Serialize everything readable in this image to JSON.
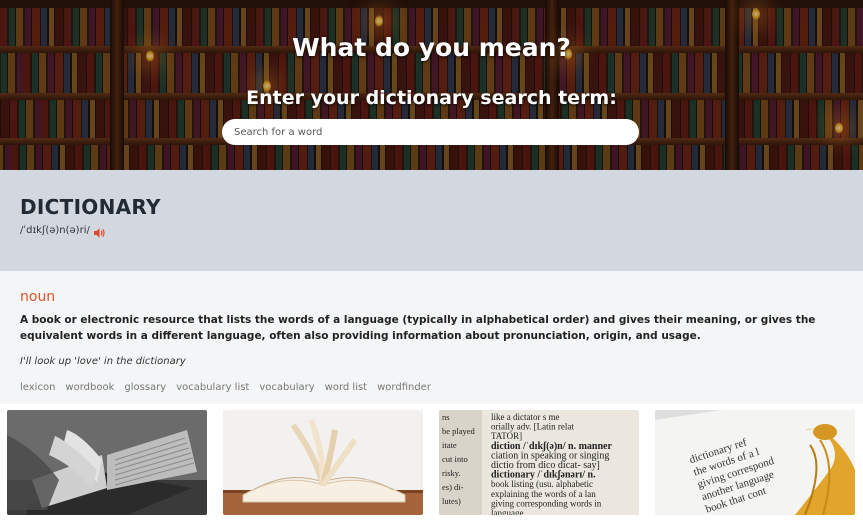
{
  "hero": {
    "title": "What do you mean?",
    "subtitle": "Enter your dictionary search term:",
    "search_placeholder": "Search for a word",
    "search_value": ""
  },
  "word": {
    "title": "DICTIONARY",
    "phonetic": "/ˈdɪkʃ(ə)n(ə)ri/",
    "audio_icon": "speaker-icon",
    "audio_color": "#e0492a"
  },
  "meaning": {
    "part_of_speech": "noun",
    "definition": "A book or electronic resource that lists the words of a language (typically in alphabetical order) and gives their meaning, or gives the equivalent words in a different language, often also providing information about pronunciation, origin, and usage.",
    "example": "I'll look up 'love' in the dictionary",
    "synonyms": [
      "lexicon",
      "wordbook",
      "glossary",
      "vocabulary list",
      "vocabulary",
      "word list",
      "wordfinder"
    ]
  },
  "images": {
    "page3_text": [
      "like a dictator  s  me",
      "orially  adv.  [Latin  relat",
      "TATOR]",
      "diction /ˈdɪkʃ(ə)n/  n. manner",
      "ciation in speaking or singing",
      "dictio from dico dicat- say]",
      "dictionary /ˈdɪkʃənərɪ/  n.",
      "book listing (usu. alphabetic",
      "explaining the words of a lan",
      "giving corresponding words in",
      "language."
    ],
    "page3_margin": [
      "ns",
      "be played",
      "itate",
      "cut into",
      "risky.",
      "es) di-",
      "lutes)"
    ],
    "page4_text": [
      "dictionary ref",
      "the words of a l",
      "giving correspond",
      "another language",
      "book that cont"
    ]
  },
  "colors": {
    "accent": "#d9552d",
    "band": "#d3d8e0",
    "heading": "#222b33"
  }
}
